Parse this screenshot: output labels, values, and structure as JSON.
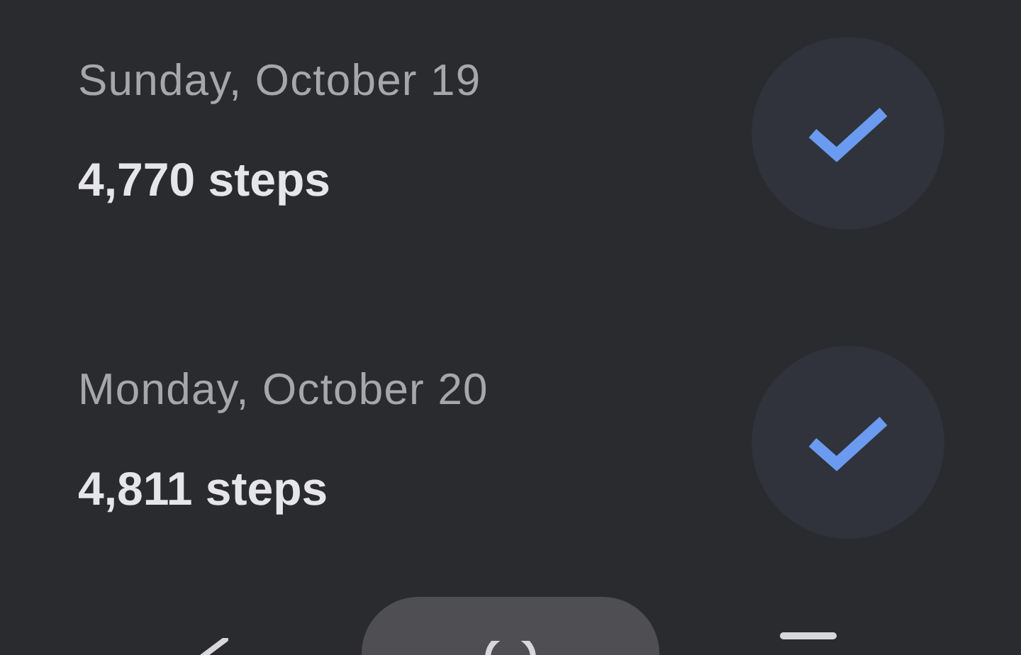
{
  "days": [
    {
      "date": "Sunday, October 19",
      "steps": "4,770 steps",
      "achieved": true
    },
    {
      "date": "Monday, October 20",
      "steps": "4,811 steps",
      "achieved": true
    }
  ],
  "nav_bar": {
    "buttons": [
      {
        "kind": "back"
      },
      {
        "kind": "home"
      },
      {
        "kind": "recents"
      }
    ]
  }
}
